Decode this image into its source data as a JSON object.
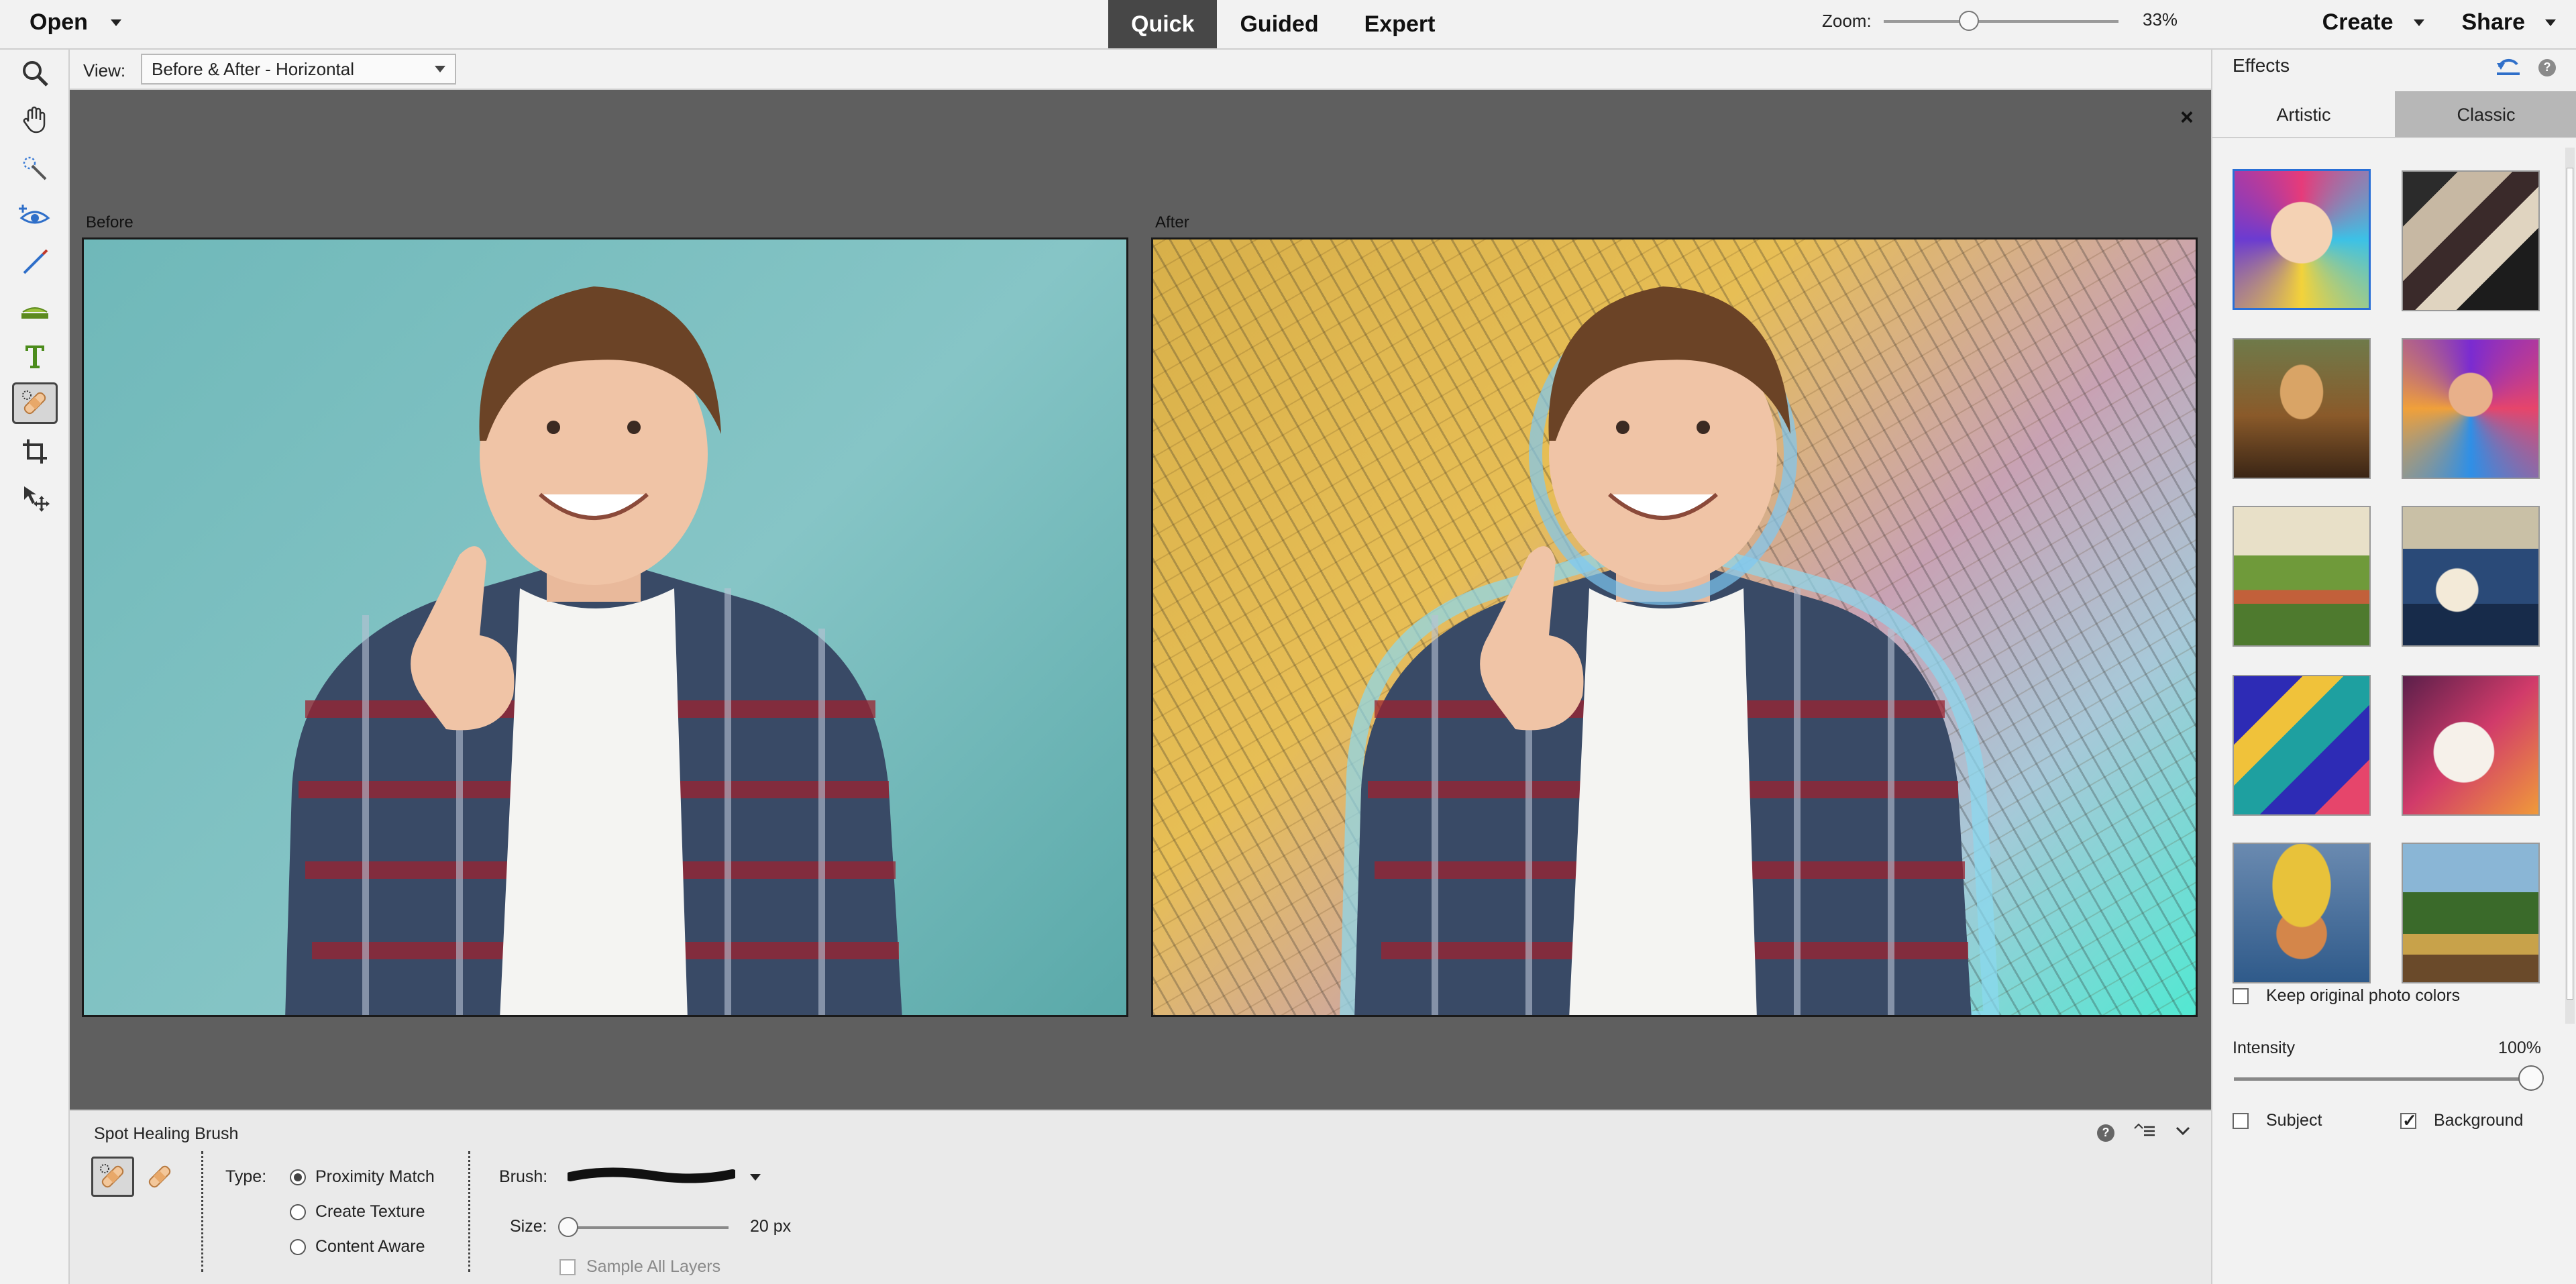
{
  "topbar": {
    "open_label": "Open",
    "modes": [
      "Quick",
      "Guided",
      "Expert"
    ],
    "active_mode": "Quick",
    "create_label": "Create",
    "share_label": "Share"
  },
  "toolbar": {
    "tools": [
      "zoom-icon",
      "hand-icon",
      "quick-selection-icon",
      "eye-icon",
      "whiten-teeth-icon",
      "straighten-icon",
      "type-icon",
      "spot-healing-icon",
      "crop-icon",
      "move-icon"
    ],
    "active_tool": "spot-healing-icon"
  },
  "options_bar": {
    "view_label": "View:",
    "view_value": "Before & After - Horizontal",
    "zoom_label": "Zoom:",
    "zoom_value": "33%",
    "zoom_level": 0.33
  },
  "canvas": {
    "before_label": "Before",
    "after_label": "After",
    "close_symbol": "×"
  },
  "tool_options": {
    "tool_name": "Spot Healing Brush",
    "type_label": "Type:",
    "type_options": [
      "Proximity Match",
      "Create Texture",
      "Content Aware"
    ],
    "type_selected": "Proximity Match",
    "brush_label": "Brush:",
    "size_label": "Size:",
    "size_value": "20 px",
    "sample_all_layers": "Sample All Layers"
  },
  "effects": {
    "title": "Effects",
    "tabs": [
      "Artistic",
      "Classic"
    ],
    "active_tab": "Artistic",
    "thumbnails": [
      "abstract-face",
      "cubist",
      "mona-lisa",
      "colorful-portrait",
      "impressionist-village",
      "great-wave",
      "pop-figures",
      "dog-portrait",
      "van-gogh-hat",
      "landscape-trees"
    ],
    "selected_thumbnail": "abstract-face",
    "keep_colors_label": "Keep original photo colors",
    "keep_colors_checked": false,
    "intensity_label": "Intensity",
    "intensity_value": "100%",
    "intensity_level": 1.0,
    "subject_label": "Subject",
    "subject_checked": false,
    "background_label": "Background",
    "background_checked": true
  }
}
